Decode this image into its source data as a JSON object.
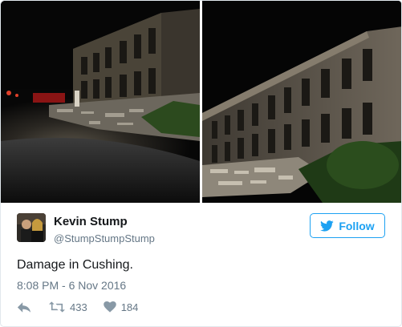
{
  "tweet": {
    "author": {
      "name": "Kevin Stump",
      "handle": "@StumpStumpStump",
      "avatar_icon": "avatar-photo"
    },
    "follow_label": "Follow",
    "text": "Damage in Cushing.",
    "timestamp": "8:08 PM - 6 Nov 2016",
    "retweets": "433",
    "likes": "184",
    "accent_color": "#1da1f2"
  },
  "media": [
    {
      "icon": "night-street-damage-photo"
    },
    {
      "icon": "building-facade-rubble-photo"
    }
  ]
}
